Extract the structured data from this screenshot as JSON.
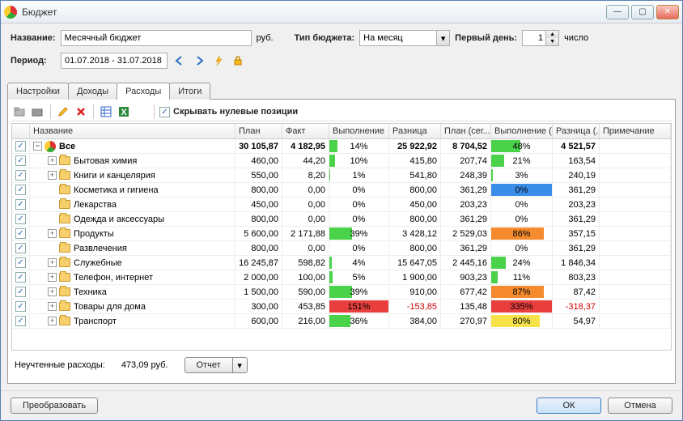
{
  "window": {
    "title": "Бюджет"
  },
  "form": {
    "name_label": "Название:",
    "name_value": "Месячный бюджет",
    "currency": "руб.",
    "type_label": "Тип бюджета:",
    "type_value": "На месяц",
    "firstday_label": "Первый день:",
    "firstday_value": "1",
    "firstday_unit": "число",
    "period_label": "Период:",
    "period_value": "01.07.2018 - 31.07.2018"
  },
  "tabs": [
    "Настройки",
    "Доходы",
    "Расходы",
    "Итоги"
  ],
  "active_tab": 2,
  "hide_zero_label": "Скрывать нулевые позиции",
  "columns": [
    "Название",
    "План",
    "Факт",
    "Выполнение",
    "Разница",
    "План (сег...",
    "Выполнение (...",
    "Разница (...",
    "Примечание"
  ],
  "rows": [
    {
      "indent": 0,
      "expand": "-",
      "icon": "pie",
      "name": "Все",
      "bold": true,
      "plan": "30 105,87",
      "fact": "4 182,95",
      "exec_pct": 14,
      "exec_color": "#4bd24b",
      "exec_text": "14%",
      "diff": "25 922,92",
      "plan2": "8 704,52",
      "exec2_pct": 48,
      "exec2_color": "#4bd24b",
      "exec2_text": "48%",
      "diff2": "4 521,57"
    },
    {
      "indent": 1,
      "expand": "+",
      "icon": "folder",
      "name": "Бытовая химия",
      "plan": "460,00",
      "fact": "44,20",
      "exec_pct": 10,
      "exec_color": "#4bd24b",
      "exec_text": "10%",
      "diff": "415,80",
      "plan2": "207,74",
      "exec2_pct": 21,
      "exec2_color": "#4bd24b",
      "exec2_text": "21%",
      "diff2": "163,54"
    },
    {
      "indent": 1,
      "expand": "+",
      "icon": "folder",
      "name": "Книги и канцелярия",
      "plan": "550,00",
      "fact": "8,20",
      "exec_pct": 1,
      "exec_color": "#4bd24b",
      "exec_text": "1%",
      "diff": "541,80",
      "plan2": "248,39",
      "exec2_pct": 3,
      "exec2_color": "#4bd24b",
      "exec2_text": "3%",
      "diff2": "240,19"
    },
    {
      "indent": 1,
      "expand": "",
      "icon": "folder",
      "name": "Косметика и гигиена",
      "plan": "800,00",
      "fact": "0,00",
      "exec_pct": 0,
      "exec_color": "#4bd24b",
      "exec_text": "0%",
      "diff": "800,00",
      "plan2": "361,29",
      "exec2_pct": 0,
      "exec2_color": "#3b8ee8",
      "exec2_full": true,
      "exec2_text": "0%",
      "diff2": "361,29"
    },
    {
      "indent": 1,
      "expand": "",
      "icon": "folder",
      "name": "Лекарства",
      "plan": "450,00",
      "fact": "0,00",
      "exec_pct": 0,
      "exec_color": "#4bd24b",
      "exec_text": "0%",
      "diff": "450,00",
      "plan2": "203,23",
      "exec2_pct": 0,
      "exec2_color": "#4bd24b",
      "exec2_text": "0%",
      "diff2": "203,23"
    },
    {
      "indent": 1,
      "expand": "",
      "icon": "folder",
      "name": "Одежда и аксессуары",
      "plan": "800,00",
      "fact": "0,00",
      "exec_pct": 0,
      "exec_color": "#4bd24b",
      "exec_text": "0%",
      "diff": "800,00",
      "plan2": "361,29",
      "exec2_pct": 0,
      "exec2_color": "#4bd24b",
      "exec2_text": "0%",
      "diff2": "361,29"
    },
    {
      "indent": 1,
      "expand": "+",
      "icon": "folder",
      "name": "Продукты",
      "plan": "5 600,00",
      "fact": "2 171,88",
      "exec_pct": 39,
      "exec_color": "#4bd24b",
      "exec_text": "39%",
      "diff": "3 428,12",
      "plan2": "2 529,03",
      "exec2_pct": 86,
      "exec2_color": "#f58b2e",
      "exec2_text": "86%",
      "diff2": "357,15"
    },
    {
      "indent": 1,
      "expand": "",
      "icon": "folder",
      "name": "Развлечения",
      "plan": "800,00",
      "fact": "0,00",
      "exec_pct": 0,
      "exec_color": "#4bd24b",
      "exec_text": "0%",
      "diff": "800,00",
      "plan2": "361,29",
      "exec2_pct": 0,
      "exec2_color": "#4bd24b",
      "exec2_text": "0%",
      "diff2": "361,29"
    },
    {
      "indent": 1,
      "expand": "+",
      "icon": "folder",
      "name": "Служебные",
      "plan": "16 245,87",
      "fact": "598,82",
      "exec_pct": 4,
      "exec_color": "#4bd24b",
      "exec_text": "4%",
      "diff": "15 647,05",
      "plan2": "2 445,16",
      "exec2_pct": 24,
      "exec2_color": "#4bd24b",
      "exec2_text": "24%",
      "diff2": "1 846,34"
    },
    {
      "indent": 1,
      "expand": "+",
      "icon": "folder",
      "name": "Телефон, интернет",
      "plan": "2 000,00",
      "fact": "100,00",
      "exec_pct": 5,
      "exec_color": "#4bd24b",
      "exec_text": "5%",
      "diff": "1 900,00",
      "plan2": "903,23",
      "exec2_pct": 11,
      "exec2_color": "#4bd24b",
      "exec2_text": "11%",
      "diff2": "803,23"
    },
    {
      "indent": 1,
      "expand": "+",
      "icon": "folder",
      "name": "Техника",
      "plan": "1 500,00",
      "fact": "590,00",
      "exec_pct": 39,
      "exec_color": "#4bd24b",
      "exec_text": "39%",
      "diff": "910,00",
      "plan2": "677,42",
      "exec2_pct": 87,
      "exec2_color": "#f58b2e",
      "exec2_text": "87%",
      "diff2": "87,42"
    },
    {
      "indent": 1,
      "expand": "+",
      "icon": "folder",
      "name": "Товары для дома",
      "plan": "300,00",
      "fact": "453,85",
      "exec_pct": 100,
      "exec_color": "#e83e3e",
      "exec_full": true,
      "exec_text": "151%",
      "diff": "-153,85",
      "diff_neg": true,
      "plan2": "135,48",
      "exec2_pct": 100,
      "exec2_color": "#e83e3e",
      "exec2_full": true,
      "exec2_text": "335%",
      "diff2": "-318,37",
      "diff2_neg": true
    },
    {
      "indent": 1,
      "expand": "+",
      "icon": "folder",
      "name": "Транспорт",
      "plan": "600,00",
      "fact": "216,00",
      "exec_pct": 36,
      "exec_color": "#4bd24b",
      "exec_text": "36%",
      "diff": "384,00",
      "plan2": "270,97",
      "exec2_pct": 80,
      "exec2_color": "#f7e24a",
      "exec2_text": "80%",
      "diff2": "54,97"
    }
  ],
  "footer": {
    "unacc_label": "Неучтенные расходы:",
    "unacc_value": "473,09 руб.",
    "report_btn": "Отчет"
  },
  "dialog": {
    "transform": "Преобразовать",
    "ok": "ОК",
    "cancel": "Отмена"
  }
}
